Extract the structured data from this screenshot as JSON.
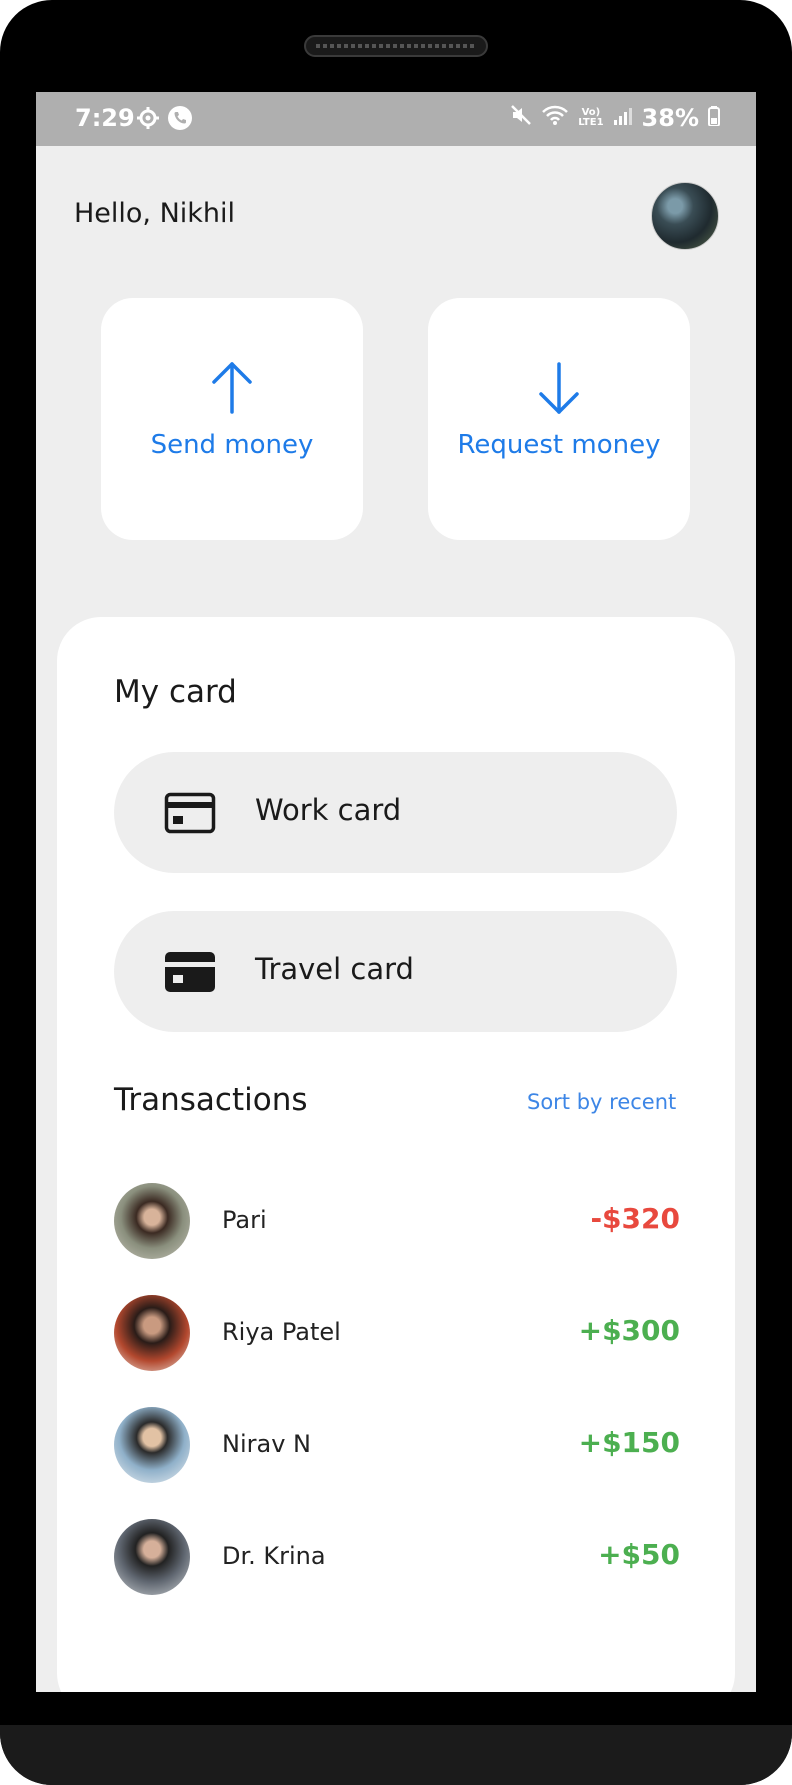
{
  "status_bar": {
    "time": "7:29",
    "left_icons": [
      "settings-icon",
      "phone-call-icon"
    ],
    "right_icons": [
      "mute-icon",
      "wifi-icon",
      "volte-icon",
      "signal-icon"
    ],
    "network_label_top": "Vo)",
    "network_label_bottom": "LTE1",
    "battery": "38%"
  },
  "header": {
    "greeting": "Hello, Nikhil",
    "avatar": "profile-avatar"
  },
  "actions": [
    {
      "label": "Send money",
      "icon": "arrow-up-icon"
    },
    {
      "label": "Request money",
      "icon": "arrow-down-icon"
    }
  ],
  "cards": {
    "title": "My card",
    "items": [
      {
        "label": "Work card",
        "icon": "credit-card-outline-icon"
      },
      {
        "label": "Travel card",
        "icon": "credit-card-filled-icon"
      }
    ]
  },
  "transactions": {
    "title": "Transactions",
    "sort_label": "Sort by recent",
    "items": [
      {
        "name": "Pari",
        "amount": "-$320",
        "type": "debit"
      },
      {
        "name": "Riya Patel",
        "amount": "+$300",
        "type": "credit"
      },
      {
        "name": "Nirav N",
        "amount": "+$150",
        "type": "credit"
      },
      {
        "name": "Dr. Krina",
        "amount": "+$50",
        "type": "credit"
      }
    ]
  },
  "colors": {
    "accent": "#1e7be8",
    "debit": "#e8493e",
    "credit": "#4caf50",
    "background": "#eeeeee",
    "status_bar": "#afafaf"
  }
}
